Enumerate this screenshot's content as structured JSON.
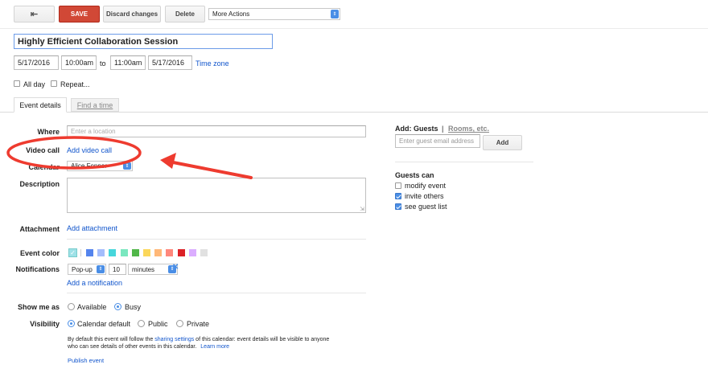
{
  "toolbar": {
    "back_icon": "back-arrow-icon",
    "save_label": "SAVE",
    "discard_label": "Discard changes",
    "delete_label": "Delete",
    "more_actions_label": "More Actions"
  },
  "event": {
    "title": "Highly Efficient Collaboration Session",
    "start_date": "5/17/2016",
    "start_time": "10:00am",
    "to_label": "to",
    "end_time": "11:00am",
    "end_date": "5/17/2016",
    "time_zone_link": "Time zone",
    "all_day_label": "All day",
    "repeat_label": "Repeat..."
  },
  "tabs": [
    {
      "label": "Event details",
      "active": true
    },
    {
      "label": "Find a time",
      "active": false
    }
  ],
  "form": {
    "where_label": "Where",
    "where_placeholder": "Enter a location",
    "video_call_label": "Video call",
    "video_call_link": "Add video call",
    "calendar_label": "Calendar",
    "calendar_value": "Alice Fenner",
    "description_label": "Description",
    "attachment_label": "Attachment",
    "attachment_link": "Add attachment",
    "event_color_label": "Event color",
    "notifications_label": "Notifications",
    "notification_method": "Pop-up",
    "notification_amount": "10",
    "notification_unit": "minutes",
    "add_notification_link": "Add a notification",
    "show_me_as_label": "Show me as",
    "show_available": "Available",
    "show_busy": "Busy",
    "visibility_label": "Visibility",
    "visibility_default": "Calendar default",
    "visibility_public": "Public",
    "visibility_private": "Private",
    "visibility_note_1": "By default this event will follow the",
    "visibility_note_link": "sharing settings",
    "visibility_note_2": "of this calendar: event details will be visible to anyone",
    "visibility_note_3": "who can see details of other events in this calendar.",
    "learn_more_link": "Learn more",
    "publish_link": "Publish event"
  },
  "colors": {
    "swatches": [
      "#5484ed",
      "#a4bdfc",
      "#46d6db",
      "#7ae7bf",
      "#51b749",
      "#fbd75b",
      "#ffb878",
      "#ff887c",
      "#dc2127",
      "#dbadff",
      "#e1e1e1"
    ],
    "selected_swatch": "#9fe1e7",
    "annotation": "#ee3b2f"
  },
  "guests": {
    "add_label": "Add:",
    "guests_tab": "Guests",
    "separator": "|",
    "rooms_tab": "Rooms, etc.",
    "email_placeholder": "Enter guest email address",
    "add_button": "Add",
    "guests_can_label": "Guests can",
    "permissions": [
      {
        "label": "modify event",
        "checked": false
      },
      {
        "label": "invite others",
        "checked": true
      },
      {
        "label": "see guest list",
        "checked": true
      }
    ]
  }
}
